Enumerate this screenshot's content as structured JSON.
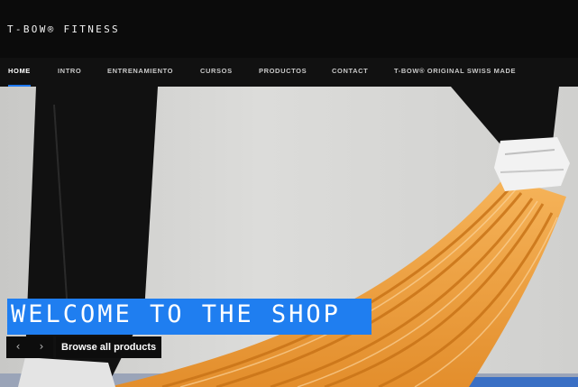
{
  "header": {
    "brand": "T-BOW® FITNESS"
  },
  "nav": {
    "items": [
      {
        "label": "HOME",
        "active": true
      },
      {
        "label": "INTRO",
        "active": false
      },
      {
        "label": "ENTRENAMIENTO",
        "active": false
      },
      {
        "label": "CURSOS",
        "active": false
      },
      {
        "label": "PRODUCTOS",
        "active": false
      },
      {
        "label": "CONTACT",
        "active": false
      },
      {
        "label": "T-BOW® ORIGINAL SWISS MADE",
        "active": false
      }
    ]
  },
  "hero": {
    "headline": "WELCOME TO THE SHOP",
    "cta_label": "Browse all products",
    "prev_icon": "chevron-left-icon",
    "next_icon": "chevron-right-icon",
    "prev_glyph": "‹",
    "next_glyph": "›"
  },
  "colors": {
    "accent": "#1f7ef0",
    "header_bg": "#0b0b0b",
    "nav_bg": "#111111",
    "bow_orange": "#f0a040"
  }
}
